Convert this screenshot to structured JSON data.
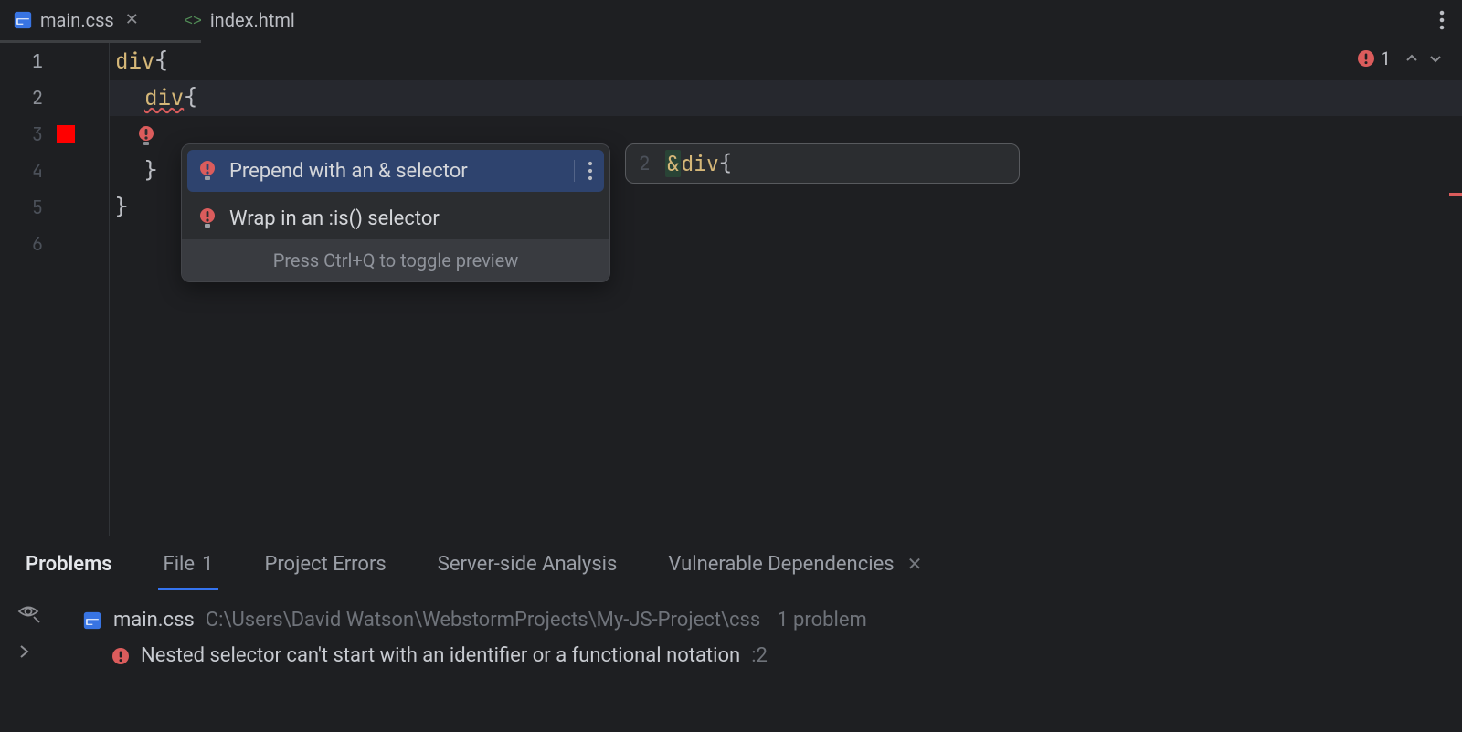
{
  "tabs": {
    "active": {
      "label": "main.css"
    },
    "other": {
      "label": "index.html"
    }
  },
  "editor": {
    "line_numbers": [
      "1",
      "2",
      "3",
      "4",
      "5",
      "6"
    ],
    "lines": {
      "l1": {
        "sel": "div",
        "brace": " {"
      },
      "l2": {
        "sel": "div",
        "brace": " {"
      },
      "l3": "",
      "l4": {
        "brace": "}"
      },
      "l5": {
        "brace": "}"
      },
      "l6": ""
    },
    "error_count": "1"
  },
  "intention": {
    "items": [
      "Prepend with an & selector",
      "Wrap in an :is() selector"
    ],
    "footer": "Press Ctrl+Q to toggle preview"
  },
  "preview": {
    "line_no": "2",
    "inserted": "&",
    "rest_sel": " div",
    "rest": " {"
  },
  "panel": {
    "title": "Problems",
    "tabs": {
      "file_label": "File",
      "file_count": "1",
      "project": "Project Errors",
      "server": "Server-side Analysis",
      "vuln": "Vulnerable Dependencies"
    },
    "file": {
      "name": "main.css",
      "path": "C:\\Users\\David Watson\\WebstormProjects\\My-JS-Project\\css",
      "count": "1 problem"
    },
    "problem": {
      "text": "Nested selector can't start with an identifier or a functional notation",
      "line": ":2"
    }
  }
}
